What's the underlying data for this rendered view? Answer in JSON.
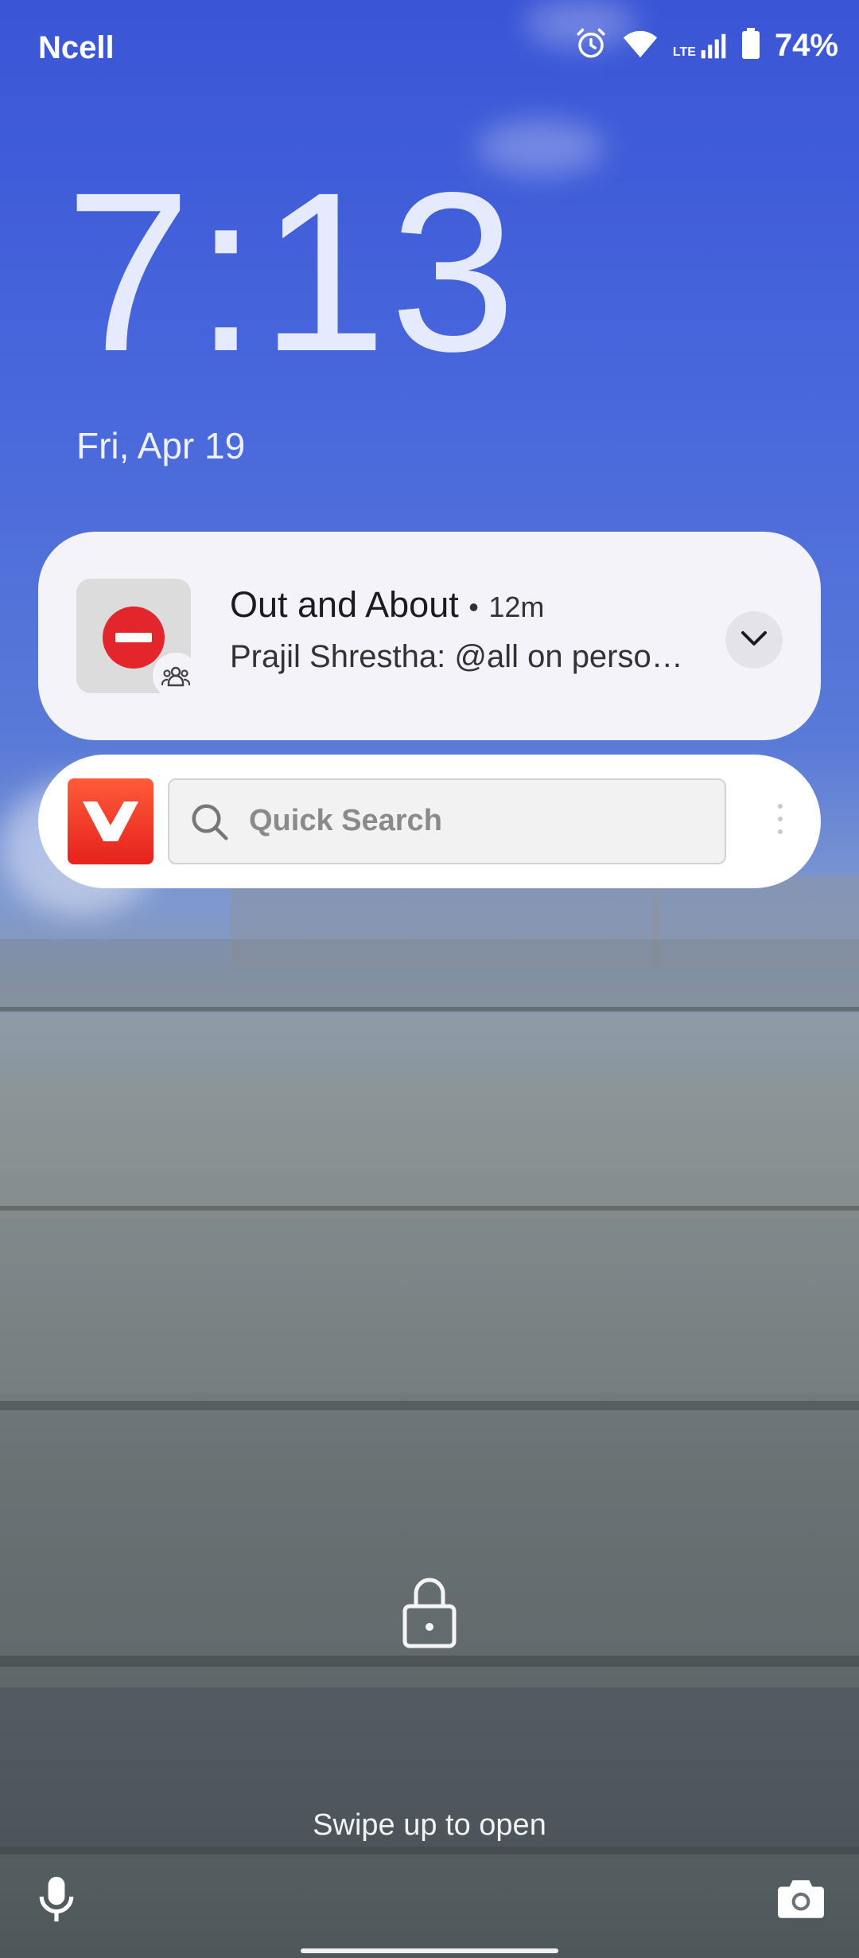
{
  "status_bar": {
    "carrier": "Ncell",
    "lte_label": "LTE",
    "battery_percent": "74%",
    "icons": [
      "alarm-icon",
      "wifi-icon",
      "signal-icon",
      "battery-icon"
    ]
  },
  "lockscreen": {
    "time": "7:13",
    "date": "Fri, Apr 19"
  },
  "notification": {
    "title": "Out and About",
    "separator": "•",
    "time_ago": "12m",
    "text": "Prajil Shrestha: @all on perso…",
    "icons": [
      "group-avatar-icon",
      "group-badge-icon",
      "chevron-down-icon"
    ]
  },
  "search_widget": {
    "app_logo": "vidmate-logo-icon",
    "placeholder": "Quick Search"
  },
  "bottom": {
    "swipe_hint": "Swipe up to open",
    "icons": [
      "lock-icon",
      "microphone-icon",
      "camera-icon"
    ]
  },
  "colors": {
    "sky": "#3a55d6",
    "card_bg": "#f4f3fa",
    "stop_red": "#e3262c",
    "app_red": "#e6221d"
  }
}
